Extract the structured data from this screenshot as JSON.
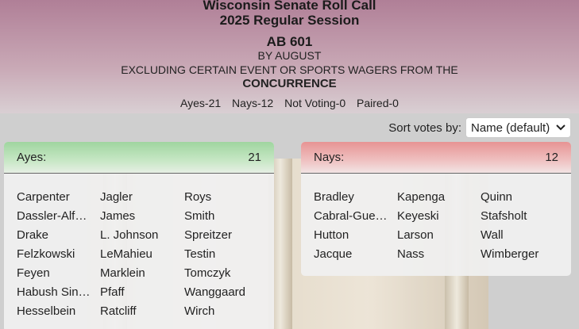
{
  "header": {
    "title_line1": "Wisconsin Senate Roll Call",
    "title_line2": "2025 Regular Session",
    "bill": "AB 601",
    "author": "BY AUGUST",
    "description": "EXCLUDING CERTAIN EVENT OR SPORTS WAGERS FROM THE",
    "motion": "CONCURRENCE"
  },
  "counts": {
    "ayes": "Ayes-21",
    "nays": "Nays-12",
    "not_voting": "Not Voting-0",
    "paired": "Paired-0"
  },
  "sort": {
    "label": "Sort votes by:",
    "selected": "Name (default)"
  },
  "ayes": {
    "label": "Ayes:",
    "count": "21",
    "names": [
      "Carpenter",
      "Dassler-Alf…",
      "Drake",
      "Felzkowski",
      "Feyen",
      "Habush Sin…",
      "Hesselbein",
      "Jagler",
      "James",
      "L. Johnson",
      "LeMahieu",
      "Marklein",
      "Pfaff",
      "Ratcliff",
      "Roys",
      "Smith",
      "Spreitzer",
      "Testin",
      "Tomczyk",
      "Wanggaard",
      "Wirch"
    ]
  },
  "nays": {
    "label": "Nays:",
    "count": "12",
    "names": [
      "Bradley",
      "Cabral-Gue…",
      "Hutton",
      "Jacque",
      "Kapenga",
      "Keyeski",
      "Larson",
      "Nass",
      "Quinn",
      "Stafsholt",
      "Wall",
      "Wimberger"
    ]
  }
}
